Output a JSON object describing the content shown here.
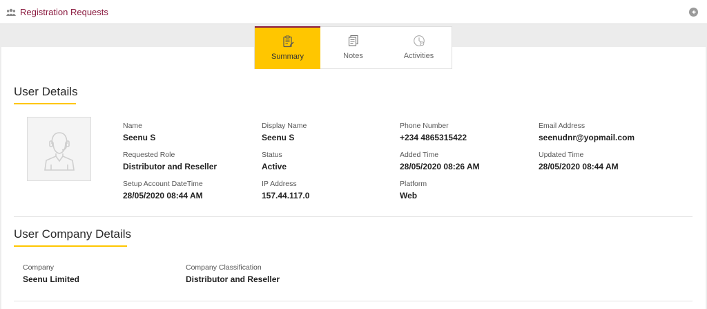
{
  "header": {
    "title": "Registration Requests"
  },
  "tabs": [
    {
      "label": "Summary",
      "icon": "clipboard-icon",
      "active": true
    },
    {
      "label": "Notes",
      "icon": "notes-icon",
      "active": false
    },
    {
      "label": "Activities",
      "icon": "activities-icon",
      "active": false
    }
  ],
  "user_details": {
    "title": "User Details",
    "fields": [
      {
        "label": "Name",
        "value": "Seenu S"
      },
      {
        "label": "Display Name",
        "value": "Seenu S"
      },
      {
        "label": "Phone Number",
        "value": "+234 4865315422"
      },
      {
        "label": "Email Address",
        "value": "seenudnr@yopmail.com"
      },
      {
        "label": "Requested Role",
        "value": "Distributor and Reseller"
      },
      {
        "label": "Status",
        "value": "Active"
      },
      {
        "label": "Added Time",
        "value": "28/05/2020 08:26 AM"
      },
      {
        "label": "Updated Time",
        "value": "28/05/2020 08:44 AM"
      },
      {
        "label": "Setup Account DateTime",
        "value": "28/05/2020 08:44 AM"
      },
      {
        "label": "IP Address",
        "value": "157.44.117.0"
      },
      {
        "label": "Platform",
        "value": "Web"
      }
    ]
  },
  "company_details": {
    "title": "User Company Details",
    "fields": [
      {
        "label": "Company",
        "value": "Seenu Limited"
      },
      {
        "label": "Company Classification",
        "value": "Distributor and Reseller"
      }
    ]
  },
  "colors": {
    "accent": "#ffc600",
    "brand": "#8a1a3f"
  }
}
